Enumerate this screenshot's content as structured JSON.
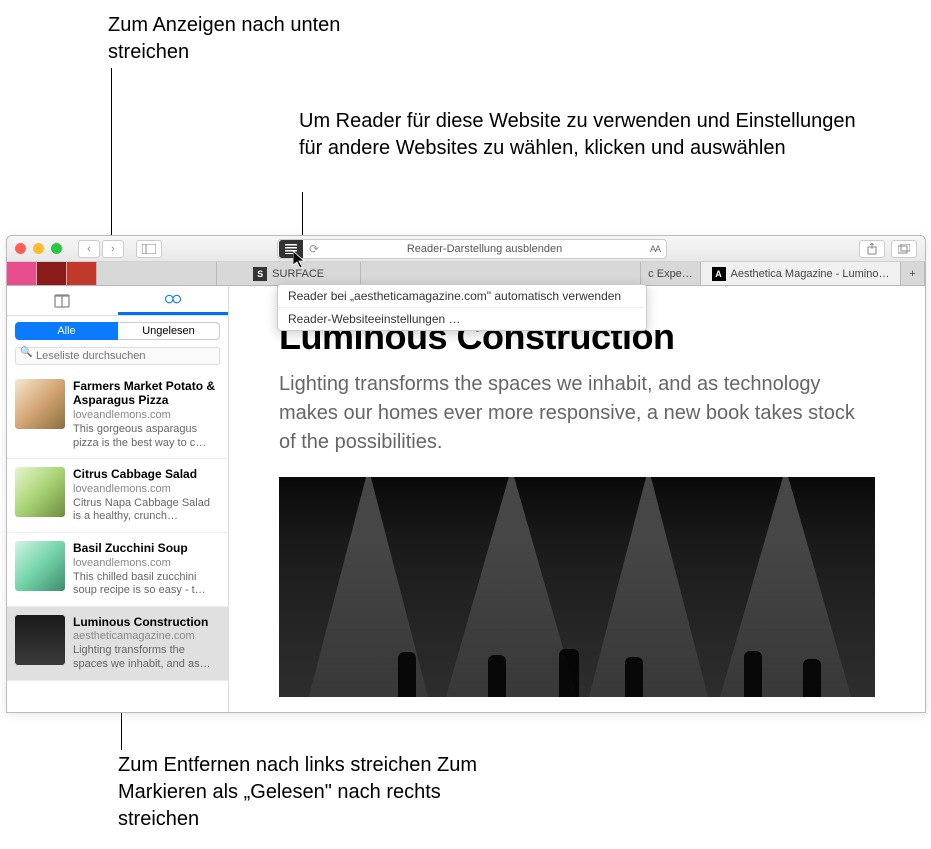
{
  "callouts": {
    "top": "Zum Anzeigen nach unten streichen",
    "reader": "Um Reader für diese Website zu verwenden und Einstellungen für andere Websites zu wählen, klicken und auswählen",
    "bottom": "Zum Entfernen nach links streichen Zum Markieren als „Gelesen\" nach rechts streichen"
  },
  "urlbar": {
    "text": "Reader-Darstellung ausblenden",
    "fontBtn": "AA"
  },
  "dropdown": {
    "item1": "Reader bei „aestheticamagazine.com\" automatisch verwenden",
    "item2": "Reader-Websiteeinstellungen …"
  },
  "tabs": [
    {
      "label": "SURFACE",
      "iconLetter": "S"
    },
    {
      "label": "c Expe…"
    },
    {
      "label": "Aesthetica Magazine - Lumino…",
      "iconLetter": "A"
    }
  ],
  "sidebar": {
    "segments": {
      "all": "Alle",
      "unread": "Ungelesen"
    },
    "searchPlaceholder": "Leseliste durchsuchen",
    "items": [
      {
        "title": "Farmers Market Potato & Asparagus Pizza",
        "domain": "loveandlemons.com",
        "desc": "This gorgeous asparagus pizza is the best way to c…"
      },
      {
        "title": "Citrus Cabbage Salad",
        "domain": "loveandlemons.com",
        "desc": "Citrus Napa Cabbage Salad is a healthy, crunch…"
      },
      {
        "title": "Basil Zucchini Soup",
        "domain": "loveandlemons.com",
        "desc": "This chilled basil zucchini soup recipe is so easy - t…"
      },
      {
        "title": "Luminous Construction",
        "domain": "aestheticamagazine.com",
        "desc": "Lighting transforms the spaces we inhabit, and as…"
      }
    ]
  },
  "article": {
    "title": "Luminous Construction",
    "lede": "Lighting transforms the spaces we inhabit, and as technology makes our homes ever more responsive, a new book takes stock of the possibilities."
  }
}
